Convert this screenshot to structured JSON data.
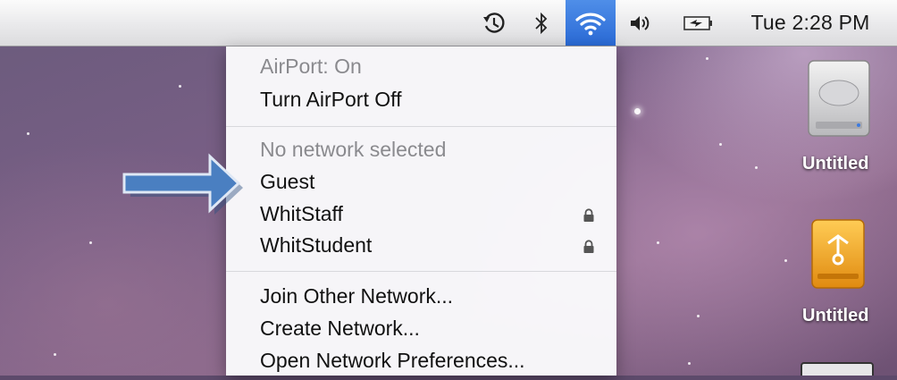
{
  "menubar": {
    "icons": [
      "time-machine-icon",
      "bluetooth-icon",
      "airport-wifi-icon",
      "volume-icon",
      "battery-icon"
    ],
    "clock": "Tue 2:28 PM"
  },
  "airport_menu": {
    "status": "AirPort: On",
    "toggle": "Turn AirPort Off",
    "network_header": "No network selected",
    "networks": [
      {
        "name": "Guest",
        "locked": false
      },
      {
        "name": "WhitStaff",
        "locked": true
      },
      {
        "name": "WhitStudent",
        "locked": true
      }
    ],
    "join_other": "Join Other Network...",
    "create": "Create Network...",
    "preferences": "Open Network Preferences..."
  },
  "desktop": {
    "icons": [
      {
        "label": "Untitled",
        "icon": "hard-drive-icon"
      },
      {
        "label": "Untitled",
        "icon": "firewire-drive-icon"
      }
    ]
  },
  "colors": {
    "airport_highlight": "#3b7fe0",
    "arrow_fill": "#4a7fc1"
  }
}
